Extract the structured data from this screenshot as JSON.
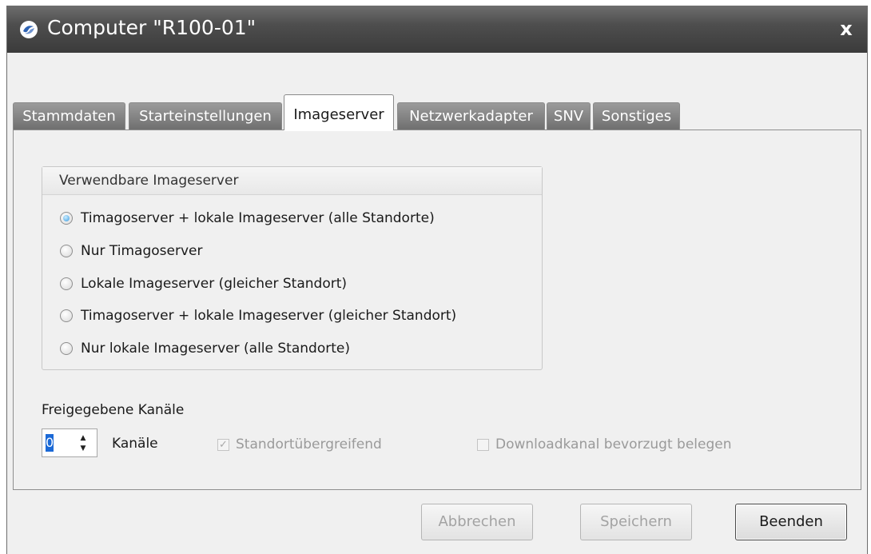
{
  "window": {
    "title": "Computer \"R100-01\"",
    "close_glyph": "x"
  },
  "tabs": [
    {
      "label": "Stammdaten",
      "active": false
    },
    {
      "label": "Starteinstellungen",
      "active": false
    },
    {
      "label": "Imageserver",
      "active": true
    },
    {
      "label": "Netzwerkadapter",
      "active": false
    },
    {
      "label": "SNV",
      "active": false
    },
    {
      "label": "Sonstiges",
      "active": false
    }
  ],
  "imageserver_group": {
    "title": "Verwendbare Imageserver",
    "options": [
      {
        "label": "Timagoserver + lokale Imageserver (alle Standorte)",
        "selected": true
      },
      {
        "label": "Nur Timagoserver",
        "selected": false
      },
      {
        "label": "Lokale Imageserver (gleicher Standort)",
        "selected": false
      },
      {
        "label": "Timagoserver + lokale Imageserver (gleicher Standort)",
        "selected": false
      },
      {
        "label": "Nur lokale Imageserver (alle Standorte)",
        "selected": false
      }
    ]
  },
  "channels": {
    "section_label": "Freigegebene Kanäle",
    "value": "0",
    "unit_label": "Kanäle",
    "site_spanning": {
      "label": "Standortübergreifend",
      "checked": true,
      "enabled": false
    },
    "download_channel": {
      "label": "Downloadkanal bevorzugt belegen",
      "checked": false,
      "enabled": false
    }
  },
  "buttons": {
    "cancel": {
      "label": "Abbrechen",
      "enabled": false
    },
    "save": {
      "label": "Speichern",
      "enabled": false
    },
    "close": {
      "label": "Beenden",
      "enabled": true
    }
  },
  "colors": {
    "titlebar": "#4e4e4e",
    "selected_radio": "#3b9be0",
    "spin_selection": "#1b69d6"
  },
  "icons": {
    "app": "timago-logo-icon",
    "close": "close-icon",
    "spin_up": "arrow-up-icon",
    "spin_down": "arrow-down-icon"
  }
}
